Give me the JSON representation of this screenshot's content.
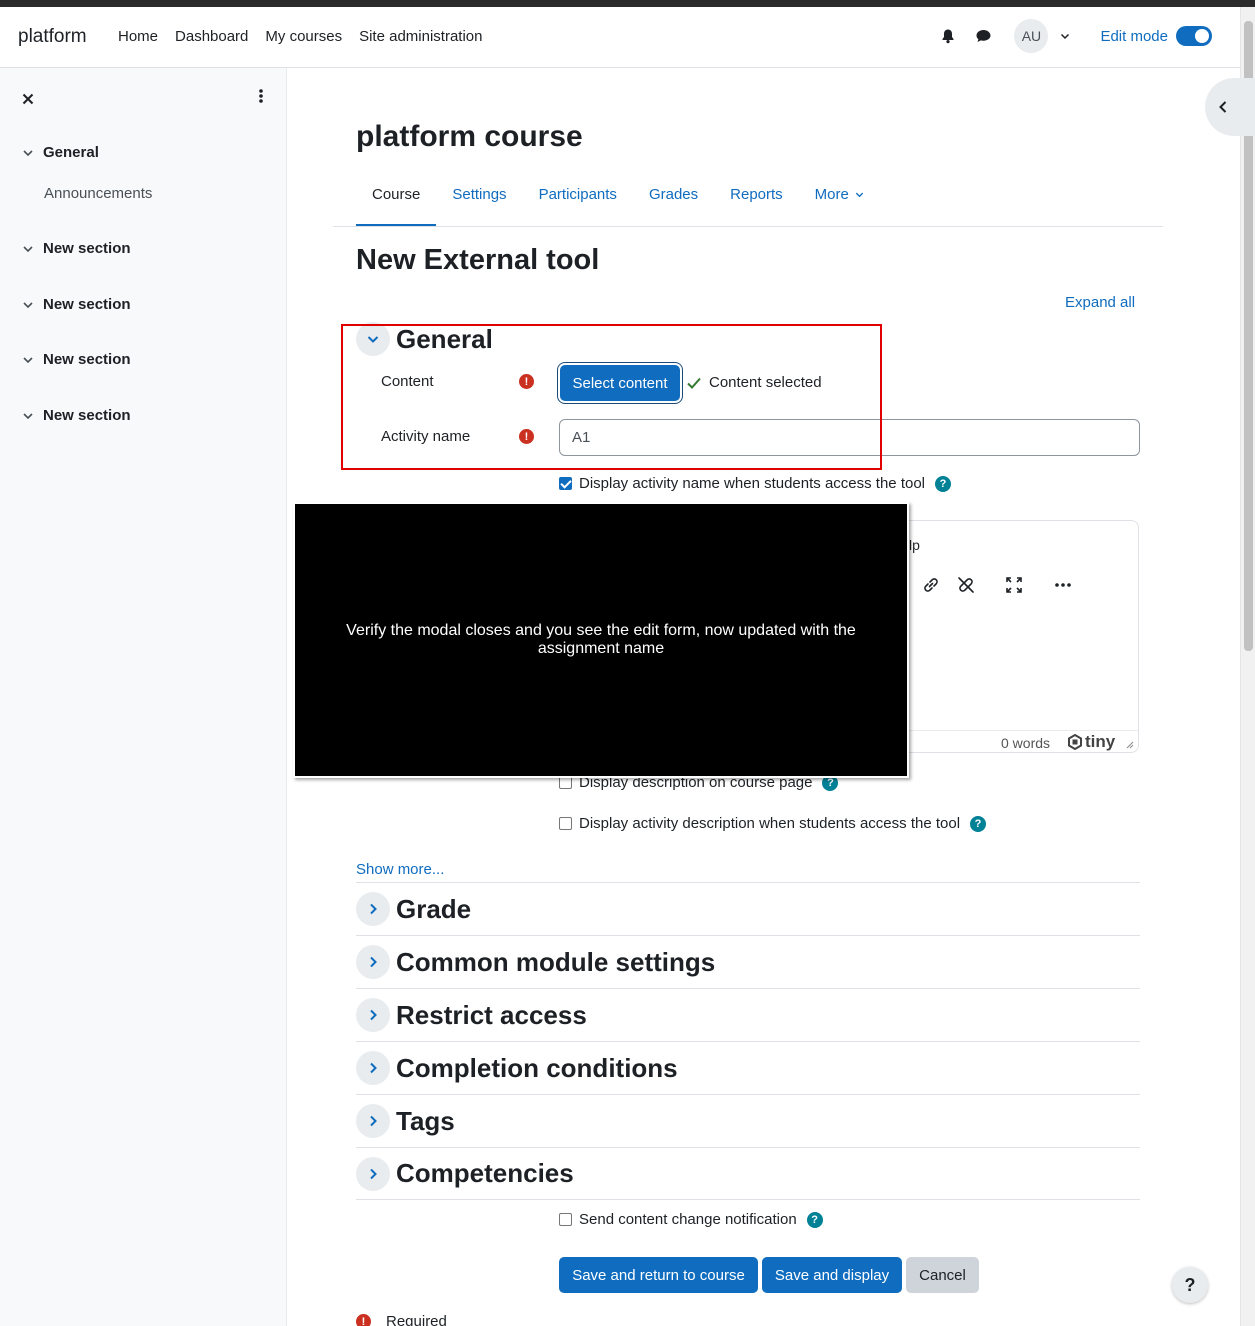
{
  "navbar": {
    "brand": "platform",
    "links": [
      "Home",
      "Dashboard",
      "My courses",
      "Site administration"
    ],
    "avatar_initials": "AU",
    "edit_mode_label": "Edit mode",
    "edit_mode_on": true
  },
  "drawer": {
    "sections": [
      {
        "label": "General",
        "items": [
          "Announcements"
        ]
      },
      {
        "label": "New section"
      },
      {
        "label": "New section"
      },
      {
        "label": "New section"
      },
      {
        "label": "New section"
      }
    ]
  },
  "course": {
    "title": "platform course",
    "tabs": [
      "Course",
      "Settings",
      "Participants",
      "Grades",
      "Reports",
      "More"
    ],
    "active_tab": "Course"
  },
  "form": {
    "page_title": "New External tool",
    "expand_all": "Expand all",
    "general_legend": "General",
    "content_label": "Content",
    "select_content_button": "Select content",
    "content_selected_text": "Content selected",
    "activity_name_label": "Activity name",
    "activity_name_value": "A1",
    "display_name_checkbox": "Display activity name when students access the tool",
    "editor_menu_partial": "lp",
    "editor_word_count": "0 words",
    "editor_brand": "tiny",
    "display_desc_course_page": "Display description on course page",
    "display_desc_students": "Display activity description when students access the tool",
    "show_more": "Show more...",
    "sections": [
      "Grade",
      "Common module settings",
      "Restrict access",
      "Completion conditions",
      "Tags",
      "Competencies"
    ],
    "send_notification": "Send content change notification",
    "buttons": {
      "save_return": "Save and return to course",
      "save_display": "Save and display",
      "cancel": "Cancel"
    },
    "required_note": "Required"
  },
  "overlay": {
    "caption": "Verify the modal closes and you see the edit form, now updated with the assignment name"
  },
  "colors": {
    "primary": "#0f6cbf",
    "required": "#ca3120",
    "help": "#008196",
    "annotation_box": "#e00000"
  }
}
